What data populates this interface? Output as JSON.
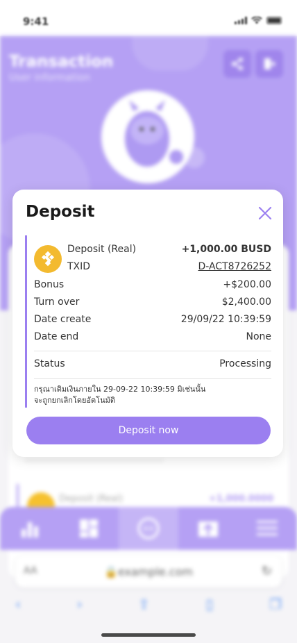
{
  "status_bar": {
    "time": "9:41"
  },
  "background": {
    "title": "Transaction",
    "subtitle": "User information",
    "list_item_label": "Deposit (Real)",
    "list_item_value": "+1,000.0000"
  },
  "modal": {
    "title": "Deposit",
    "deposit_label": "Deposit (Real)",
    "deposit_value": "+1,000.00 BUSD",
    "txid_label": "TXID",
    "txid_value": "D-ACT8726252",
    "rows": [
      {
        "label": "Bonus",
        "value": "+$200.00"
      },
      {
        "label": "Turn over",
        "value": "$2,400.00"
      },
      {
        "label": "Date create",
        "value": "29/09/22 10:39:59"
      },
      {
        "label": "Date end",
        "value": "None"
      }
    ],
    "status_label": "Status",
    "status_value": "Processing",
    "note_line1": "กรุณาเติมเงินภายใน 29-09-22 10:39:59 มิเช่นนั้น",
    "note_line2": "จะถูกยกเลิกโดยอัตโนมัติ",
    "button_label": "Deposit now"
  },
  "browser": {
    "aa": "AA",
    "url": "example.com"
  },
  "colors": {
    "accent": "#9b7ff0",
    "status_processing": "#f2a20b",
    "coin": "#f3ba2f"
  }
}
